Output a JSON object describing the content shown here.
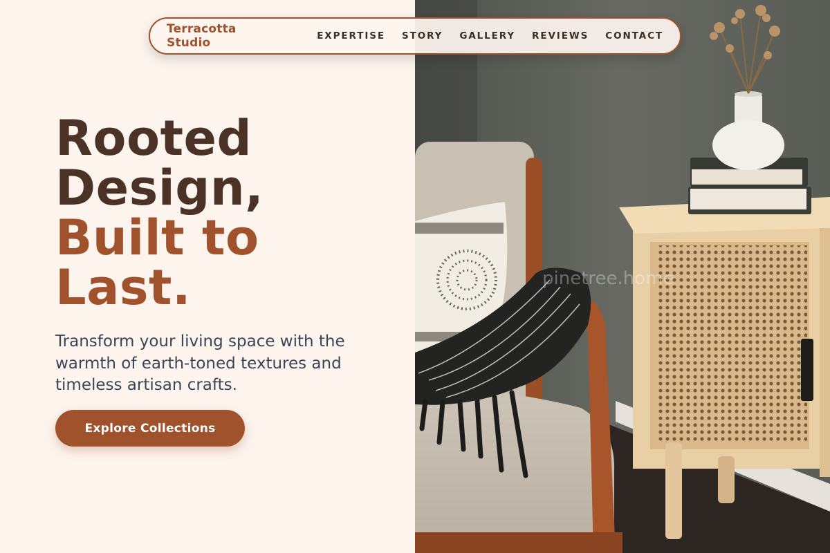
{
  "nav": {
    "brand": "Terracotta Studio",
    "links": [
      {
        "label": "EXPERTISE"
      },
      {
        "label": "STORY"
      },
      {
        "label": "GALLERY"
      },
      {
        "label": "REVIEWS"
      },
      {
        "label": "CONTACT"
      }
    ]
  },
  "hero": {
    "title_lines": [
      "Rooted",
      "Design,"
    ],
    "accent_lines": [
      "Built to",
      "Last."
    ],
    "subtitle": "Transform your living space with the warmth of earth-toned textures and timeless artisan crafts.",
    "cta_label": "Explore Collections"
  },
  "image": {
    "watermark": "pinetree.home",
    "subject_icons": [
      "armchair",
      "throw-pillow",
      "knit-throw-blanket",
      "rattan-cabinet",
      "book-stack",
      "ceramic-vase",
      "dried-flowers"
    ]
  },
  "colors": {
    "page_background": "#fdf4ee",
    "brand_accent": "#a0522d",
    "heading_dark": "#4a3326",
    "body_text": "#3a4656",
    "wall_gray": "#5e605a"
  }
}
